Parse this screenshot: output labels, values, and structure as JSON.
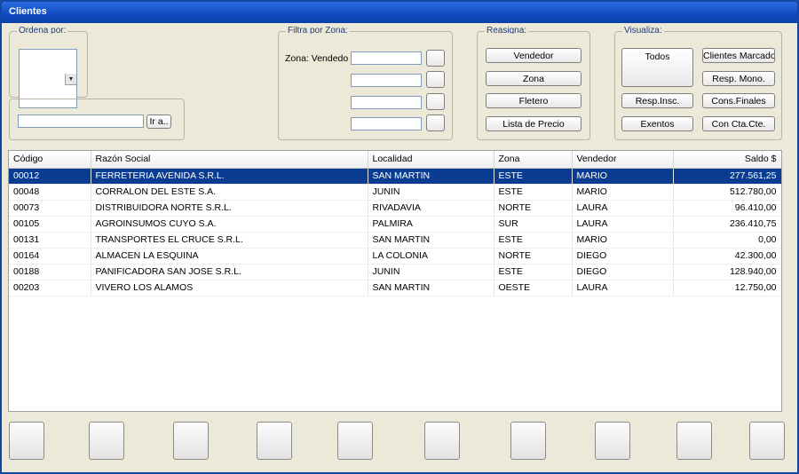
{
  "window": {
    "title": "Clientes"
  },
  "ordena": {
    "label": "Ordena por:",
    "search_value": "",
    "go_button": "Ir a.."
  },
  "filtra": {
    "label": "Filtra por Zona:",
    "zona_label": "Zona: Vendedor"
  },
  "reasigna": {
    "label": "Reasigna:",
    "buttons": [
      "Vendedor",
      "Zona",
      "Fletero",
      "Lista de Precio"
    ]
  },
  "visualiza": {
    "label": "Visualiza:",
    "todos": "Todos",
    "clientes_marcados": "Clientes Marcados",
    "resp_mono": "Resp. Mono.",
    "resp_insc": "Resp.Insc.",
    "cons_finales": "Cons.Finales",
    "exentos": "Exentos",
    "con_cta_cte": "Con Cta.Cte."
  },
  "grid": {
    "headers": [
      "Código",
      "Razón Social",
      "Localidad",
      "Zona",
      "Vendedor",
      "Saldo $"
    ],
    "rows": [
      [
        "00012",
        "FERRETERIA AVENIDA S.R.L.",
        "SAN MARTIN",
        "ESTE",
        "MARIO",
        "277.561,25"
      ],
      [
        "00048",
        "CORRALON DEL ESTE S.A.",
        "JUNIN",
        "ESTE",
        "MARIO",
        "512.780,00"
      ],
      [
        "00073",
        "DISTRIBUIDORA NORTE S.R.L.",
        "RIVADAVIA",
        "NORTE",
        "LAURA",
        "96.410,00"
      ],
      [
        "00105",
        "AGROINSUMOS CUYO S.A.",
        "PALMIRA",
        "SUR",
        "LAURA",
        "236.410,75"
      ],
      [
        "00131",
        "TRANSPORTES EL CRUCE S.R.L.",
        "SAN MARTIN",
        "ESTE",
        "MARIO",
        "0,00"
      ],
      [
        "00164",
        "ALMACEN LA ESQUINA",
        "LA COLONIA",
        "NORTE",
        "DIEGO",
        "42.300,00"
      ],
      [
        "00188",
        "PANIFICADORA SAN JOSE S.R.L.",
        "JUNIN",
        "ESTE",
        "DIEGO",
        "128.940,00"
      ],
      [
        "00203",
        "VIVERO LOS ALAMOS",
        "SAN MARTIN",
        "OESTE",
        "LAURA",
        "12.750,00"
      ]
    ],
    "selected_row": 0
  },
  "colors": {
    "title_bar": "#0f4bc0",
    "selection": "#0a3d91",
    "background": "#ece9d8"
  }
}
